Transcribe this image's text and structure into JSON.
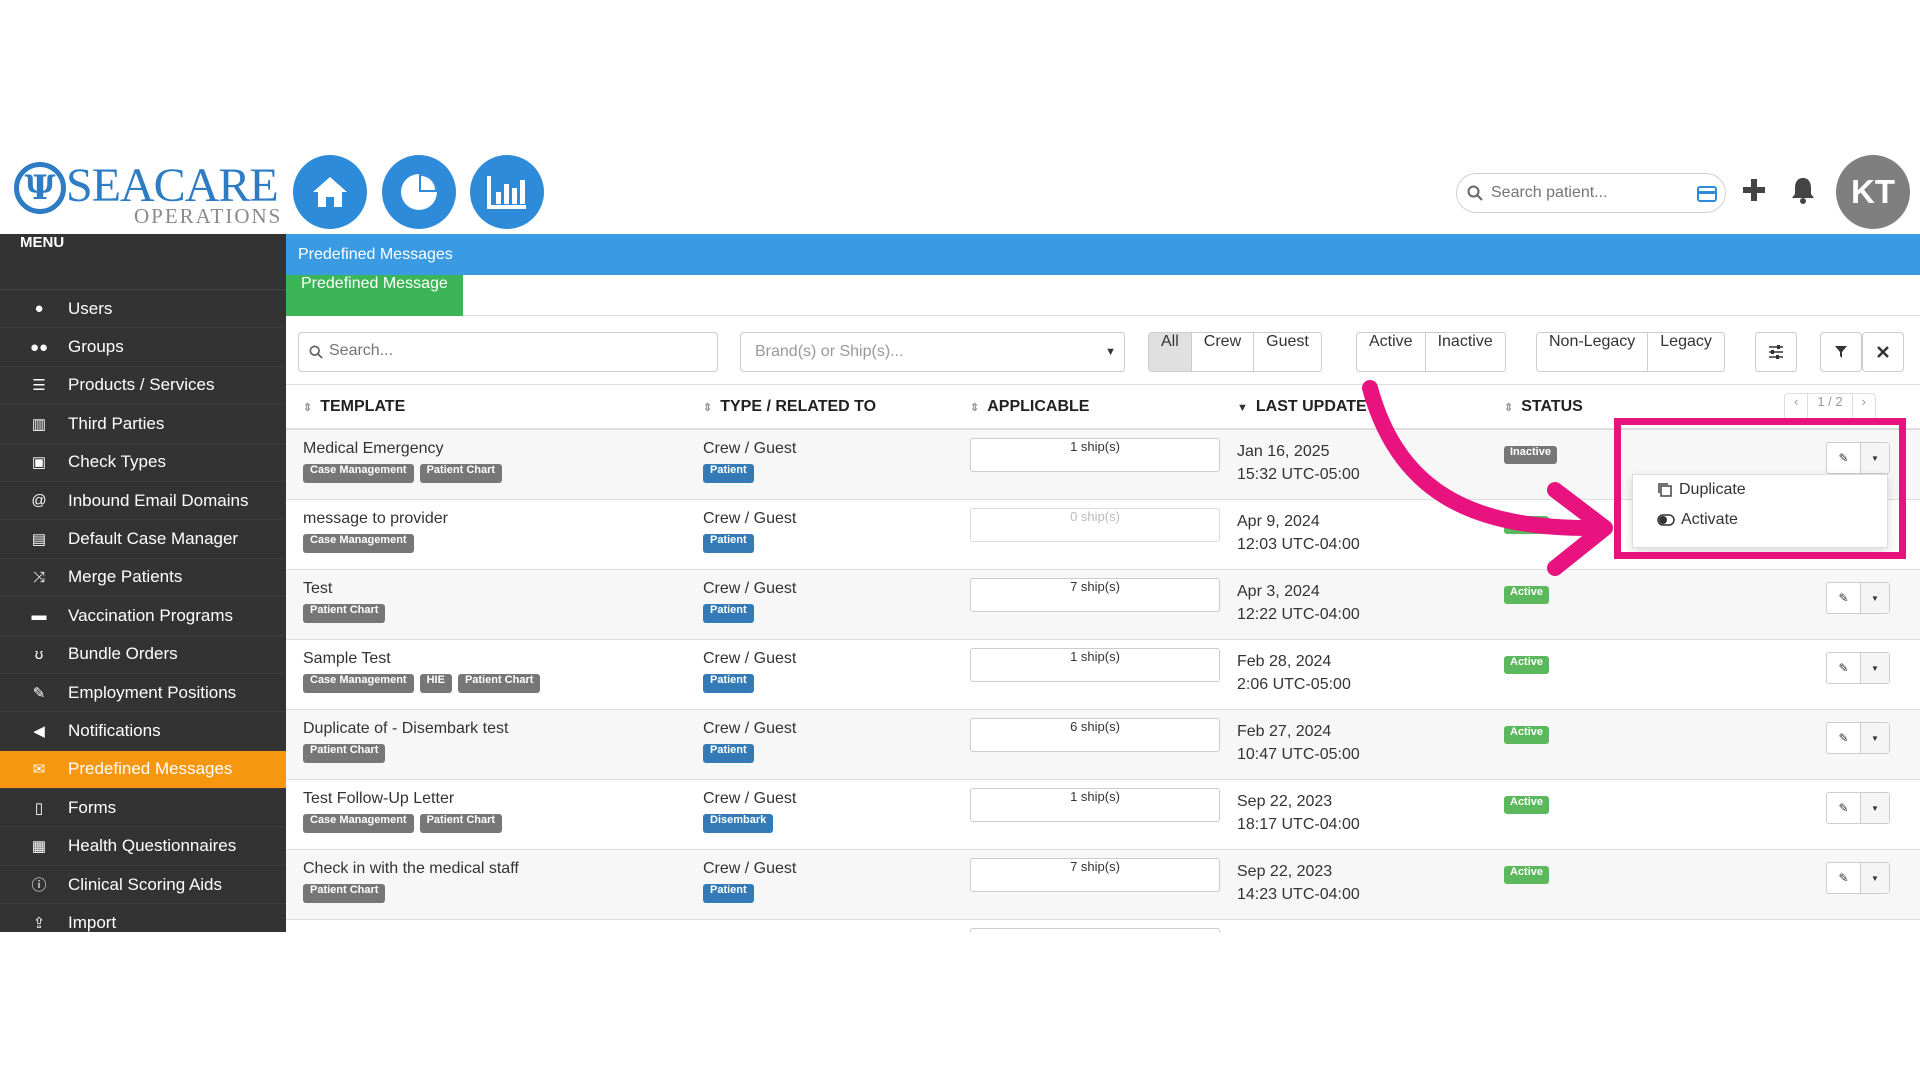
{
  "header": {
    "logo_text": "SEACARE",
    "logo_subtext": "OPERATIONS",
    "search_placeholder": "Search patient...",
    "avatar_initials": "KT"
  },
  "sidebar": {
    "title": "MENU",
    "items": [
      {
        "label": "Users",
        "icon": "user-icon"
      },
      {
        "label": "Groups",
        "icon": "group-icon"
      },
      {
        "label": "Products / Services",
        "icon": "list-icon"
      },
      {
        "label": "Third Parties",
        "icon": "building-icon"
      },
      {
        "label": "Check Types",
        "icon": "money-icon"
      },
      {
        "label": "Inbound Email Domains",
        "icon": "at-icon"
      },
      {
        "label": "Default Case Manager",
        "icon": "id-card-icon"
      },
      {
        "label": "Merge Patients",
        "icon": "merge-icon"
      },
      {
        "label": "Vaccination Programs",
        "icon": "briefcase-icon"
      },
      {
        "label": "Bundle Orders",
        "icon": "stethoscope-icon"
      },
      {
        "label": "Employment Positions",
        "icon": "wrench-icon"
      },
      {
        "label": "Notifications",
        "icon": "bullhorn-icon"
      },
      {
        "label": "Predefined Messages",
        "icon": "envelope-icon",
        "active": true
      },
      {
        "label": "Forms",
        "icon": "file-icon"
      },
      {
        "label": "Health Questionnaires",
        "icon": "form-icon"
      },
      {
        "label": "Clinical Scoring Aids",
        "icon": "info-icon"
      },
      {
        "label": "Import",
        "icon": "upload-icon"
      }
    ]
  },
  "main": {
    "breadcrumb": "Predefined Messages",
    "tab": "Predefined Message",
    "filters": {
      "search_placeholder": "Search...",
      "brand_placeholder": "Brand(s) or Ship(s)...",
      "type_buttons": [
        "All",
        "Crew",
        "Guest"
      ],
      "status_buttons": [
        "Active",
        "Inactive"
      ],
      "legacy_buttons": [
        "Non-Legacy",
        "Legacy"
      ]
    },
    "columns": {
      "template": "TEMPLATE",
      "type": "TYPE / RELATED TO",
      "applicable": "APPLICABLE",
      "last_update": "LAST UPDATE",
      "status": "STATUS"
    },
    "pager": {
      "prev": "‹",
      "page": "1 / 2",
      "next": "›"
    },
    "rows": [
      {
        "name": "Medical Emergency",
        "tags": [
          "Case Management",
          "Patient Chart"
        ],
        "type": "Crew / Guest",
        "related": "Patient",
        "ships": "1 ship(s)",
        "date": "Jan 16, 2025",
        "time": "15:32 UTC-05:00",
        "status": "Inactive"
      },
      {
        "name": "message to provider",
        "tags": [
          "Case Management"
        ],
        "type": "Crew / Guest",
        "related": "Patient",
        "ships": "0 ship(s)",
        "date": "Apr 9, 2024",
        "time": "12:03 UTC-04:00",
        "status": "Active"
      },
      {
        "name": "Test",
        "tags": [
          "Patient Chart"
        ],
        "type": "Crew / Guest",
        "related": "Patient",
        "ships": "7 ship(s)",
        "date": "Apr 3, 2024",
        "time": "12:22 UTC-04:00",
        "status": "Active"
      },
      {
        "name": "Sample Test",
        "tags": [
          "Case Management",
          "HIE",
          "Patient Chart"
        ],
        "type": "Crew / Guest",
        "related": "Patient",
        "ships": "1 ship(s)",
        "date": "Feb 28, 2024",
        "time": "2:06 UTC-05:00",
        "status": "Active"
      },
      {
        "name": "Duplicate of - Disembark test",
        "tags": [
          "Patient Chart"
        ],
        "type": "Crew / Guest",
        "related": "Patient",
        "ships": "6 ship(s)",
        "date": "Feb 27, 2024",
        "time": "10:47 UTC-05:00",
        "status": "Active"
      },
      {
        "name": "Test Follow-Up Letter",
        "tags": [
          "Case Management",
          "Patient Chart"
        ],
        "type": "Crew / Guest",
        "related": "Disembark",
        "ships": "1 ship(s)",
        "date": "Sep 22, 2023",
        "time": "18:17 UTC-04:00",
        "status": "Active"
      },
      {
        "name": "Check in with the medical staff",
        "tags": [
          "Patient Chart"
        ],
        "type": "Crew / Guest",
        "related": "Patient",
        "ships": "7 ship(s)",
        "date": "Sep 22, 2023",
        "time": "14:23 UTC-04:00",
        "status": "Active"
      }
    ],
    "dropdown": [
      {
        "label": "Duplicate",
        "icon": "copy-icon"
      },
      {
        "label": "Activate",
        "icon": "toggle-icon"
      }
    ]
  },
  "colors": {
    "accent_blue": "#3a9be3",
    "active_orange": "#f7960f",
    "tab_green": "#3cb556",
    "highlight_pink": "#e8137e",
    "status_active": "#5cb85c",
    "status_inactive": "#777777"
  }
}
